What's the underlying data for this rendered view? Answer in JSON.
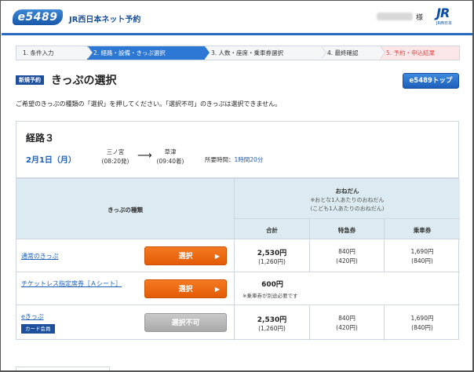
{
  "header": {
    "logo_text": "e5489",
    "site_title": "JR西日本ネット予約",
    "user_suffix": "様",
    "jr_logo": "JR",
    "jr_logo_sub": "JR西日本"
  },
  "steps": [
    {
      "label": "1. 条件入力",
      "state": "done"
    },
    {
      "label": "2. 経路・設備・きっぷ選択",
      "state": "active"
    },
    {
      "label": "3. 人数・座席・乗車券選択",
      "state": "todo"
    },
    {
      "label": "4. 最終確認",
      "state": "todo"
    },
    {
      "label": "5. 予約・申込結果",
      "state": "last"
    }
  ],
  "page": {
    "badge": "新規予約",
    "title": "きっぷの選択",
    "top_button": "e5489トップ",
    "instruction": "ご希望のきっぷの種類の「選択」を押してください。「選択不可」のきっぷは選択できません。"
  },
  "route": {
    "name": "経路３",
    "date": "2月1日（月）",
    "from_station": "三ノ宮",
    "from_time": "(08:20発)",
    "to_station": "草津",
    "to_time": "(09:40着)",
    "arrow": "⟶",
    "duration_label": "所要時間：",
    "duration_value": "1時間20分"
  },
  "table": {
    "col_type_header": "きっぷの種類",
    "price_header": "おねだん",
    "price_note1": "※おとな1人あたりのおねだん",
    "price_note2": "(こども1人あたりのおねだん)",
    "col_total": "合計",
    "col_express": "特急券",
    "col_fare": "乗車券",
    "rows": [
      {
        "name": "通常のきっぷ",
        "button": "選択",
        "enabled": true,
        "total": "2,530円",
        "total_child": "(1,260円)",
        "express": "840円",
        "express_child": "(420円)",
        "fare": "1,690円",
        "fare_child": "(840円)"
      },
      {
        "name": "チケットレス指定席券［Ａシート］",
        "button": "選択",
        "enabled": true,
        "total": "600円",
        "note": "※乗車券が別途必要です"
      },
      {
        "name": "eきっぷ",
        "badge": "カード会員",
        "button": "選択不可",
        "enabled": false,
        "total": "2,530円",
        "total_child": "(1,260円)",
        "express": "840円",
        "express_child": "(420円)",
        "fare": "1,690円",
        "fare_child": "(840円)"
      }
    ]
  },
  "colors": {
    "brand_blue": "#2c78d4",
    "select_orange": "#f57a22",
    "header_bg": "#dcebf1"
  }
}
